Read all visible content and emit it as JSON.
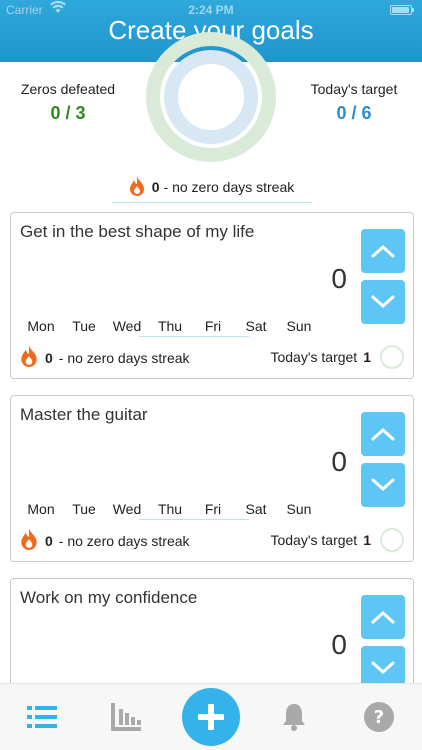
{
  "status_bar": {
    "carrier": "Carrier",
    "time": "2:24 PM"
  },
  "header": {
    "title": "Create your goals"
  },
  "summary": {
    "zeros_label": "Zeros defeated",
    "zeros_value": "0 / 3",
    "target_label": "Today's target",
    "target_value": "0 / 6",
    "streak_count": "0",
    "streak_text": "- no zero days streak"
  },
  "days": [
    "Mon",
    "Tue",
    "Wed",
    "Thu",
    "Fri",
    "Sat",
    "Sun"
  ],
  "goals": [
    {
      "title": "Get in the best shape of my life",
      "count": "0",
      "streak_count": "0",
      "streak_text": "- no zero days streak",
      "target_label": "Today's target",
      "target_value": "1"
    },
    {
      "title": "Master the guitar",
      "count": "0",
      "streak_count": "0",
      "streak_text": "- no zero days streak",
      "target_label": "Today's target",
      "target_value": "1"
    },
    {
      "title": "Work on my confidence",
      "count": "0"
    }
  ],
  "tabbar": {
    "icons": [
      "list-icon",
      "stats-icon",
      "add-icon",
      "bell-icon",
      "help-icon"
    ]
  },
  "colors": {
    "accent": "#34b3ea",
    "header": "#1f95cd",
    "green": "#2e8b1e",
    "blue_value": "#2a8fc9",
    "flame": "#f06a1d"
  }
}
